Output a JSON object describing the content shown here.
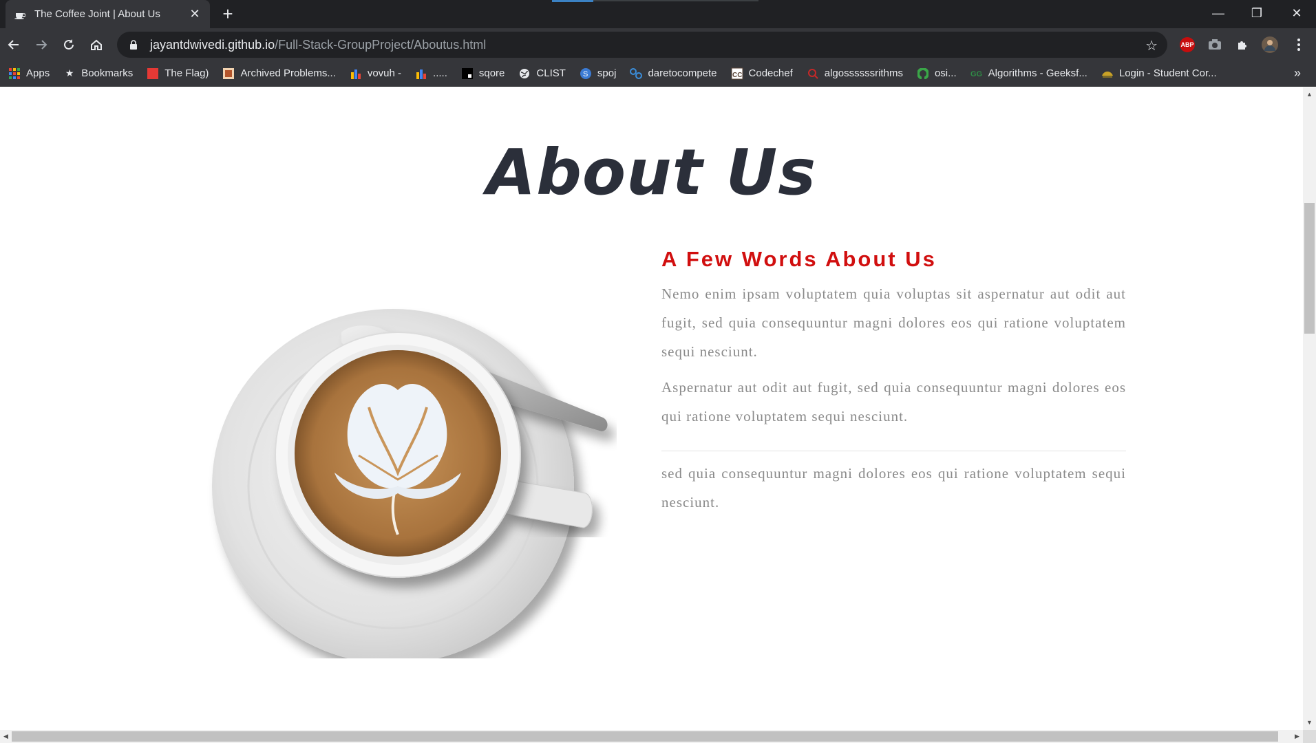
{
  "browser": {
    "tab_title": "The Coffee Joint | About Us",
    "tab_close": "✕",
    "new_tab": "+",
    "window_controls": {
      "minimize": "—",
      "restore": "❐",
      "close": "✕"
    },
    "url_host": "jayantdwivedi.github.io",
    "url_path": "/Full-Stack-GroupProject/Aboutus.html",
    "abp_label": "ABP",
    "bookmarks": [
      {
        "label": "Apps",
        "icon": "apps-grid-icon"
      },
      {
        "label": "Bookmarks",
        "icon": "star-icon"
      },
      {
        "label": "The Flag)",
        "icon": "flag-icon"
      },
      {
        "label": "Archived Problems...",
        "icon": "archive-icon"
      },
      {
        "label": "vovuh -",
        "icon": "bar-chart-icon"
      },
      {
        "label": ".....",
        "icon": "bar-chart-icon"
      },
      {
        "label": "sqore",
        "icon": "square-icon"
      },
      {
        "label": "CLIST",
        "icon": "globe-icon"
      },
      {
        "label": "spoj",
        "icon": "spoj-icon"
      },
      {
        "label": "daretocompete",
        "icon": "link-icon"
      },
      {
        "label": "Codechef",
        "icon": "codechef-icon"
      },
      {
        "label": "algossssssrithms",
        "icon": "search-icon"
      },
      {
        "label": "osi...",
        "icon": "osi-icon"
      },
      {
        "label": "Algorithms - Geeksf...",
        "icon": "geeks-icon"
      },
      {
        "label": "Login - Student Cor...",
        "icon": "login-icon"
      }
    ],
    "bookmarks_more": "»"
  },
  "page": {
    "title": "About Us",
    "section_heading": "A Few Words About Us",
    "paragraphs": [
      "Nemo enim ipsam voluptatem quia voluptas sit aspernatur aut odit aut fugit, sed quia consequuntur magni dolores eos qui ratione voluptatem sequi nesciunt.",
      "Aspernatur aut odit aut fugit, sed quia consequuntur magni dolores eos qui ratione voluptatem sequi nesciunt.",
      "sed quia consequuntur magni dolores eos qui ratione voluptatem sequi nesciunt."
    ],
    "image": "coffee-cup-latte-art",
    "colors": {
      "heading_red": "#d10f0f",
      "title_dark": "#2b2f3a",
      "text_gray": "#8a8a8a"
    }
  }
}
